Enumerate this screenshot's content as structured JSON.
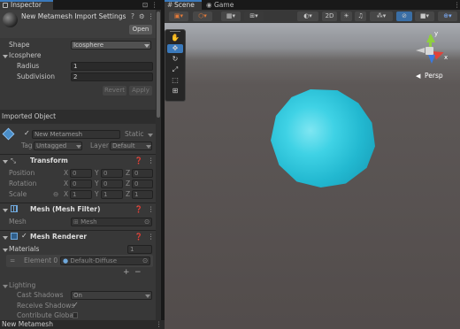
{
  "inspector": {
    "tab": "Inspector",
    "asset_title": "New Metamesh Import Settings",
    "open_label": "Open",
    "help_icon": "?",
    "settings_icon": "⚙",
    "menu_icon": "⋮"
  },
  "settings": {
    "shape_label": "Shape",
    "shape_value": "Icosphere",
    "section": "Icosphere",
    "radius_label": "Radius",
    "radius_value": "1",
    "subdivision_label": "Subdivision",
    "subdivision_value": "2",
    "revert": "Revert",
    "apply": "Apply"
  },
  "imported": {
    "label": "Imported Object",
    "name": "New Metamesh",
    "static": "Static",
    "tag_label": "Tag",
    "tag_value": "Untagged",
    "layer_label": "Layer",
    "layer_value": "Default"
  },
  "transform": {
    "title": "Transform",
    "position": "Position",
    "rotation": "Rotation",
    "scale": "Scale",
    "x": "X",
    "y": "Y",
    "z": "Z",
    "pos": [
      "0",
      "0",
      "0"
    ],
    "rot": [
      "0",
      "0",
      "0"
    ],
    "scl": [
      "1",
      "1",
      "1"
    ]
  },
  "mesh_filter": {
    "title": "Mesh (Mesh Filter)",
    "mesh_label": "Mesh",
    "mesh_value": "Mesh"
  },
  "mesh_renderer": {
    "title": "Mesh Renderer",
    "materials": "Materials",
    "materials_count": "1",
    "element_label": "Element 0",
    "element_value": "Default-Diffuse",
    "plus": "+",
    "minus": "−",
    "lighting": "Lighting",
    "cast_shadows": "Cast Shadows",
    "cast_value": "On",
    "receive_shadows": "Receive Shadows",
    "contribute_gi": "Contribute Global I"
  },
  "footer": {
    "label": "New Metamesh"
  },
  "scene": {
    "tab_scene": "Scene",
    "tab_game": "Game",
    "btn_2d": "2D",
    "persp": "Persp",
    "gizmo_y": "y",
    "gizmo_x": "x"
  },
  "colors": {
    "sphere": "#27c5dc",
    "accent": "#3a79bb",
    "gizmo_y": "#8fcf3f",
    "gizmo_x": "#e0423a",
    "gizmo_z": "#3a79e0"
  },
  "icons": [
    "hand-icon",
    "move-icon",
    "rotate-icon",
    "scale-icon",
    "rect-icon",
    "transform-icon",
    "lock-icon",
    "persp-cube-icon"
  ]
}
